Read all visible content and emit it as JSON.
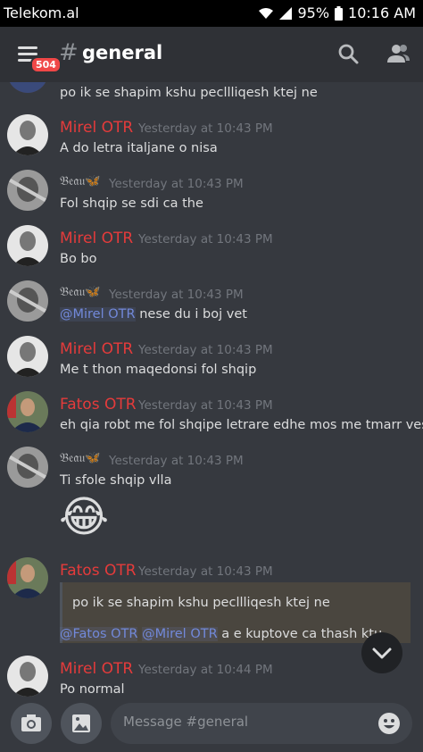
{
  "status": {
    "carrier": "Telekom.al",
    "battery": "95%",
    "clock": "10:16 AM"
  },
  "header": {
    "badge": "504",
    "hash": "#",
    "channel": "general"
  },
  "messages": [
    {
      "author": "",
      "time": "",
      "text": "po ik se shapim kshu pecllliqesh ktej ne"
    },
    {
      "author": "Mirel OTR",
      "time": "Yesterday at 10:43 PM",
      "text": "A do letra italjane o nisa"
    },
    {
      "author": "𝔅𝔢𝔞𝔲🦋",
      "time": "Yesterday at 10:43 PM",
      "text": "Fol shqip se sdi ca the"
    },
    {
      "author": "Mirel OTR",
      "time": "Yesterday at 10:43 PM",
      "text": "Bo bo"
    },
    {
      "author": "𝔅𝔢𝔞𝔲🦋",
      "time": "Yesterday at 10:43 PM",
      "mention": "@Mirel OTR",
      "text": " nese du i boj vet"
    },
    {
      "author": "Mirel OTR",
      "time": "Yesterday at 10:43 PM",
      "text": "Me t thon maqedonsi fol shqip"
    },
    {
      "author": "Fatos OTR",
      "time": "Yesterday at 10:43 PM",
      "text": "eh qia robt me fol shqipe letrare edhe mos me tmarr vesh"
    },
    {
      "author": "𝔅𝔢𝔞𝔲🦋",
      "time": "Yesterday at 10:43 PM",
      "text": "Ti sfole shqip vlla",
      "emoji": "😂"
    },
    {
      "author": "Fatos OTR",
      "time": "Yesterday at 10:43 PM",
      "quote": "po ik se shapim kshu pecllliqesh ktej ne",
      "mention1": "@Fatos OTR",
      "mention2": "@Mirel OTR",
      "text": " a e kuptove ca thash ktu"
    },
    {
      "author": "Mirel OTR",
      "time": "Yesterday at 10:44 PM",
      "text": "Po normal"
    }
  ],
  "composer": {
    "placeholder": "Message #general"
  },
  "colors": {
    "red_name": "#e53b3b",
    "mention": "#7289da",
    "header_bg": "#2f3136",
    "chat_bg": "#36393f"
  }
}
